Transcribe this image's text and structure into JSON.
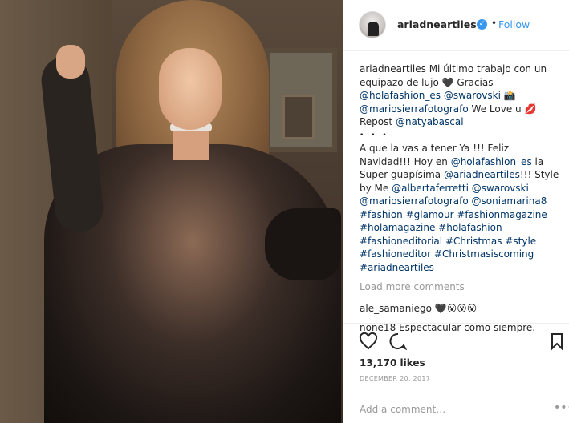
{
  "post": {
    "username": "ariadneartiles",
    "follow_label": "Follow",
    "separator": "•"
  },
  "caption": {
    "username": "ariadneartiles",
    "line1": "Mi último trabajo con un",
    "line2": "equipazo de lujo 🖤 Gracias",
    "line3a": "@holafashion_es",
    "line3b": "@swarovski",
    "line3c": "📸",
    "line4a": "@mariosierrafotografo",
    "line4b": "We Love u",
    "line4c": "💋",
    "line5a": "Repost",
    "line5b": "@natyabascal",
    "dots": "• • •"
  },
  "comment1": {
    "l1": "A que la vas a tener Ya !!! Feliz",
    "l2a": "Navidad!!! Hoy en",
    "l2b": "@holafashion_es",
    "l2c": "la",
    "l3a": "Super guapísima",
    "l3b": "@ariadneartiles",
    "l3c": "!!! Style",
    "l4a": "by Me",
    "l4b": "@albertaferretti",
    "l4c": "@swarovski",
    "l5a": "@mariosierrafotografo",
    "l5b": "@soniamarina8",
    "l6a": "#fashion",
    "l6b": "#glamour",
    "l6c": "#fashionmagazine",
    "l7a": "#holamagazine",
    "l7b": "#holafashion",
    "l8a": "#fashioneditorial",
    "l8b": "#Christmas",
    "l8c": "#style",
    "l9a": "#fashioneditor",
    "l9b": "#Christmasiscoming",
    "l10": "#ariadneartiles"
  },
  "load_more": "Load more comments",
  "comment2": {
    "user": "ale_samaniego",
    "text": "🖤😮😮😮"
  },
  "comment3": {
    "user": "none18",
    "text": "Espectacular como siempre."
  },
  "likes": "13,170 likes",
  "date": "DECEMBER 20, 2017",
  "add_comment_placeholder": "Add a comment…",
  "more_label": "•••",
  "icons": [
    "heart-icon",
    "comment-icon",
    "bookmark-icon",
    "verified-badge-icon"
  ]
}
